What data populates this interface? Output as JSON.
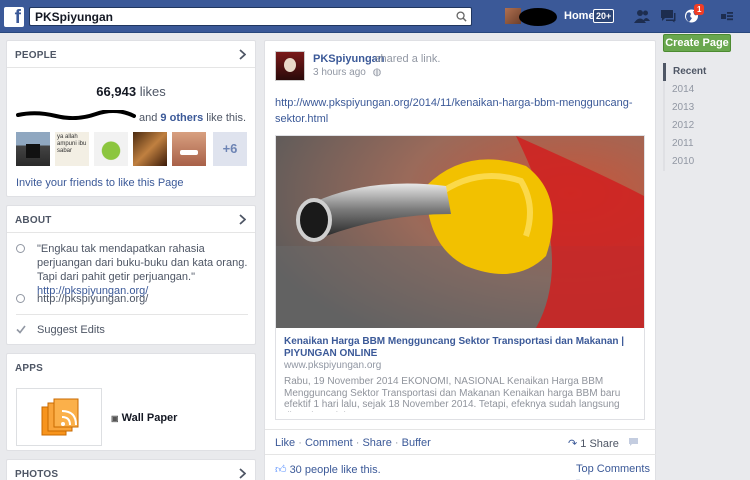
{
  "topbar": {
    "search_value": "PKSpiyungan",
    "home_label": "Home",
    "home_count": "20+",
    "notifications_count": "1"
  },
  "people": {
    "title": "PEOPLE",
    "likes_number": "66,943",
    "likes_word": "likes",
    "and_word": "and",
    "others_label": "9 others",
    "like_this": "like this.",
    "more_count": "+6",
    "invite_label": "Invite your friends to like this Page",
    "thumb_text": "ya allah ampuni ibu sabar"
  },
  "about": {
    "title": "ABOUT",
    "quote": "\"Engkau tak mendapatkan rahasia perjuangan dari buku-buku dan kata orang. Tapi dari pahit getir perjuangan.\"",
    "quote_link": "http://pkspiyungan.org/",
    "website": "http://pkspiyungan.org/",
    "suggest_edits": "Suggest Edits"
  },
  "apps": {
    "title": "APPS",
    "app_name": "Wall Paper"
  },
  "photos": {
    "title": "PHOTOS"
  },
  "post": {
    "author": "PKSpiyungan",
    "action": "shared a link.",
    "time": "3 hours ago",
    "url": "http://www.pkspiyungan.org/2014/11/kenaikan-harga-bbm-mengguncang-sektor.html",
    "card_title": "Kenaikan Harga BBM Mengguncang Sektor Transportasi dan Makanan | PIYUNGAN ONLINE",
    "card_domain": "www.pkspiyungan.org",
    "card_desc": "Rabu, 19 November 2014 EKONOMI, NASIONAL Kenaikan Harga BBM Mengguncang Sektor Transportasi dan Makanan Kenaikan harga BBM baru efektif 1 hari lalu, sejak 18 November 2014. Tetapi, efeknya sudah langsung dirasakan oleh...",
    "actions": {
      "like": "Like",
      "comment": "Comment",
      "share": "Share",
      "buffer": "Buffer",
      "sep": "·"
    },
    "share_count": "1 Share",
    "likes_text": "30 people like this.",
    "top_comments": "Top Comments"
  },
  "right": {
    "create_page": "Create Page",
    "years": [
      "Recent",
      "2014",
      "2013",
      "2012",
      "2011",
      "2010"
    ]
  },
  "colors": {
    "topbar": "#3b5998",
    "link": "#3b5998",
    "create_button": "#69a74e",
    "badge": "#f03d25"
  }
}
